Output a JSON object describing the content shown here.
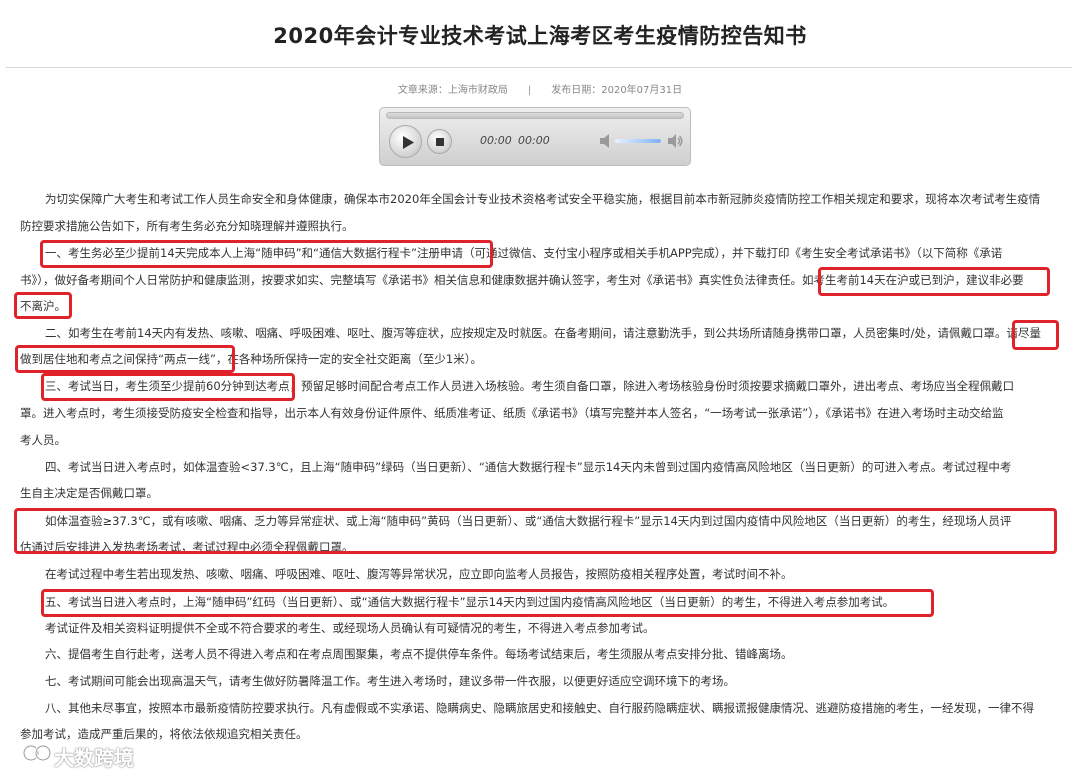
{
  "title": "2020年会计专业技术考试上海考区考生疫情防控告知书",
  "meta": {
    "source": "文章来源：上海市财政局",
    "separator": "|",
    "date": "发布日期：2020年07月31日"
  },
  "player": {
    "current_time": "00:00",
    "total_time": "00:00",
    "play_icon": "play-icon",
    "stop_icon": "stop-icon",
    "volume_icons": [
      "volume-low-icon",
      "volume-high-icon"
    ]
  },
  "highlight_color": "#e0222b",
  "lines": [
    "为切实保障广大考生和考试工作人员生命安全和身体健康，确保本市2020年全国会计专业技术资格考试安全平稳实施，根据目前本市新冠肺炎疫情防控工作相关规定和要求，现将本次考试考生疫情",
    "防控要求措施公告如下，所有考生务必充分知晓理解并遵照执行。",
    "一、考生务必至少提前14天完成本人上海“随申码”和“通信大数据行程卡”注册申请（可通过微信、支付宝小程序或相关手机APP完成），并下载打印《考生安全考试承诺书》（以下简称《承诺",
    "书》），做好备考期间个人日常防护和健康监测，按要求如实、完整填写《承诺书》相关信息和健康数据并确认签字，考生对《承诺书》真实性负法律责任。如考生考前14天在沪或已到沪，建议非必要",
    "不离沪。",
    "二、如考生在考前14天内有发热、咳嗽、咽痛、呼吸困难、呕吐、腹泻等症状，应按规定及时就医。在备考期间，请注意勤洗手，到公共场所请随身携带口罩，人员密集时/处，请佩戴口罩。请尽量",
    "做到居住地和考点之间保持“两点一线”，在各种场所保持一定的安全社交距离（至少1米）。",
    "三、考试当日，考生须至少提前60分钟到达考点，预留足够时间配合考点工作人员进入场核验。考生须自备口罩，除进入考场核验身份时须按要求摘戴口罩外，进出考点、考场应当全程佩戴口",
    "罩。进入考点时，考生须接受防疫安全检查和指导，出示本人有效身份证件原件、纸质准考证、纸质《承诺书》（填写完整并本人签名，“一场考试一张承诺”），《承诺书》在进入考场时主动交给监",
    "考人员。",
    "四、考试当日进入考点时，如体温查验<37.3℃，且上海“随申码”绿码（当日更新）、“通信大数据行程卡”显示14天内未曾到过国内疫情高风险地区（当日更新）的可进入考点。考试过程中考",
    "生自主决定是否佩戴口罩。",
    "如体温查验≥37.3℃，或有咳嗽、咽痛、乏力等异常症状、或上海“随申码”黄码（当日更新）、或“通信大数据行程卡”显示14天内到过国内疫情中风险地区（当日更新）的考生，经现场人员评",
    "估通过后安排进入发热考场考试，考试过程中必须全程佩戴口罩。",
    "在考试过程中考生若出现发热、咳嗽、咽痛、呼吸困难、呕吐、腹泻等异常状况，应立即向监考人员报告，按照防疫相关程序处置，考试时间不补。",
    "五、考试当日进入考点时，上海“随申码”红码（当日更新）、或“通信大数据行程卡”显示14天内到过国内疫情高风险地区（当日更新）的考生，不得进入考点参加考试。",
    "考试证件及相关资料证明提供不全或不符合要求的考生、或经现场人员确认有可疑情况的考生，不得进入考点参加考试。",
    "六、提倡考生自行赴考，送考人员不得进入考点和在考点周围聚集，考点不提供停车条件。每场考试结束后，考生须服从考点安排分批、错峰离场。",
    "七、考试期间可能会出现高温天气，请考生做好防暑降温工作。考生进入考场时，建议多带一件衣服，以便更好适应空调环境下的考场。",
    "八、其他未尽事宜，按照本市最新疫情防控要求执行。凡有虚假或不实承诺、隐瞒病史、隐瞒旅居史和接触史、自行服药隐瞒症状、瞒报谎报健康情况、逃避防疫措施的考生，一经发现，一律不得",
    "参加考试，造成严重后果的，将依法依规追究相关责任。"
  ],
  "watermark": "大数跨境"
}
